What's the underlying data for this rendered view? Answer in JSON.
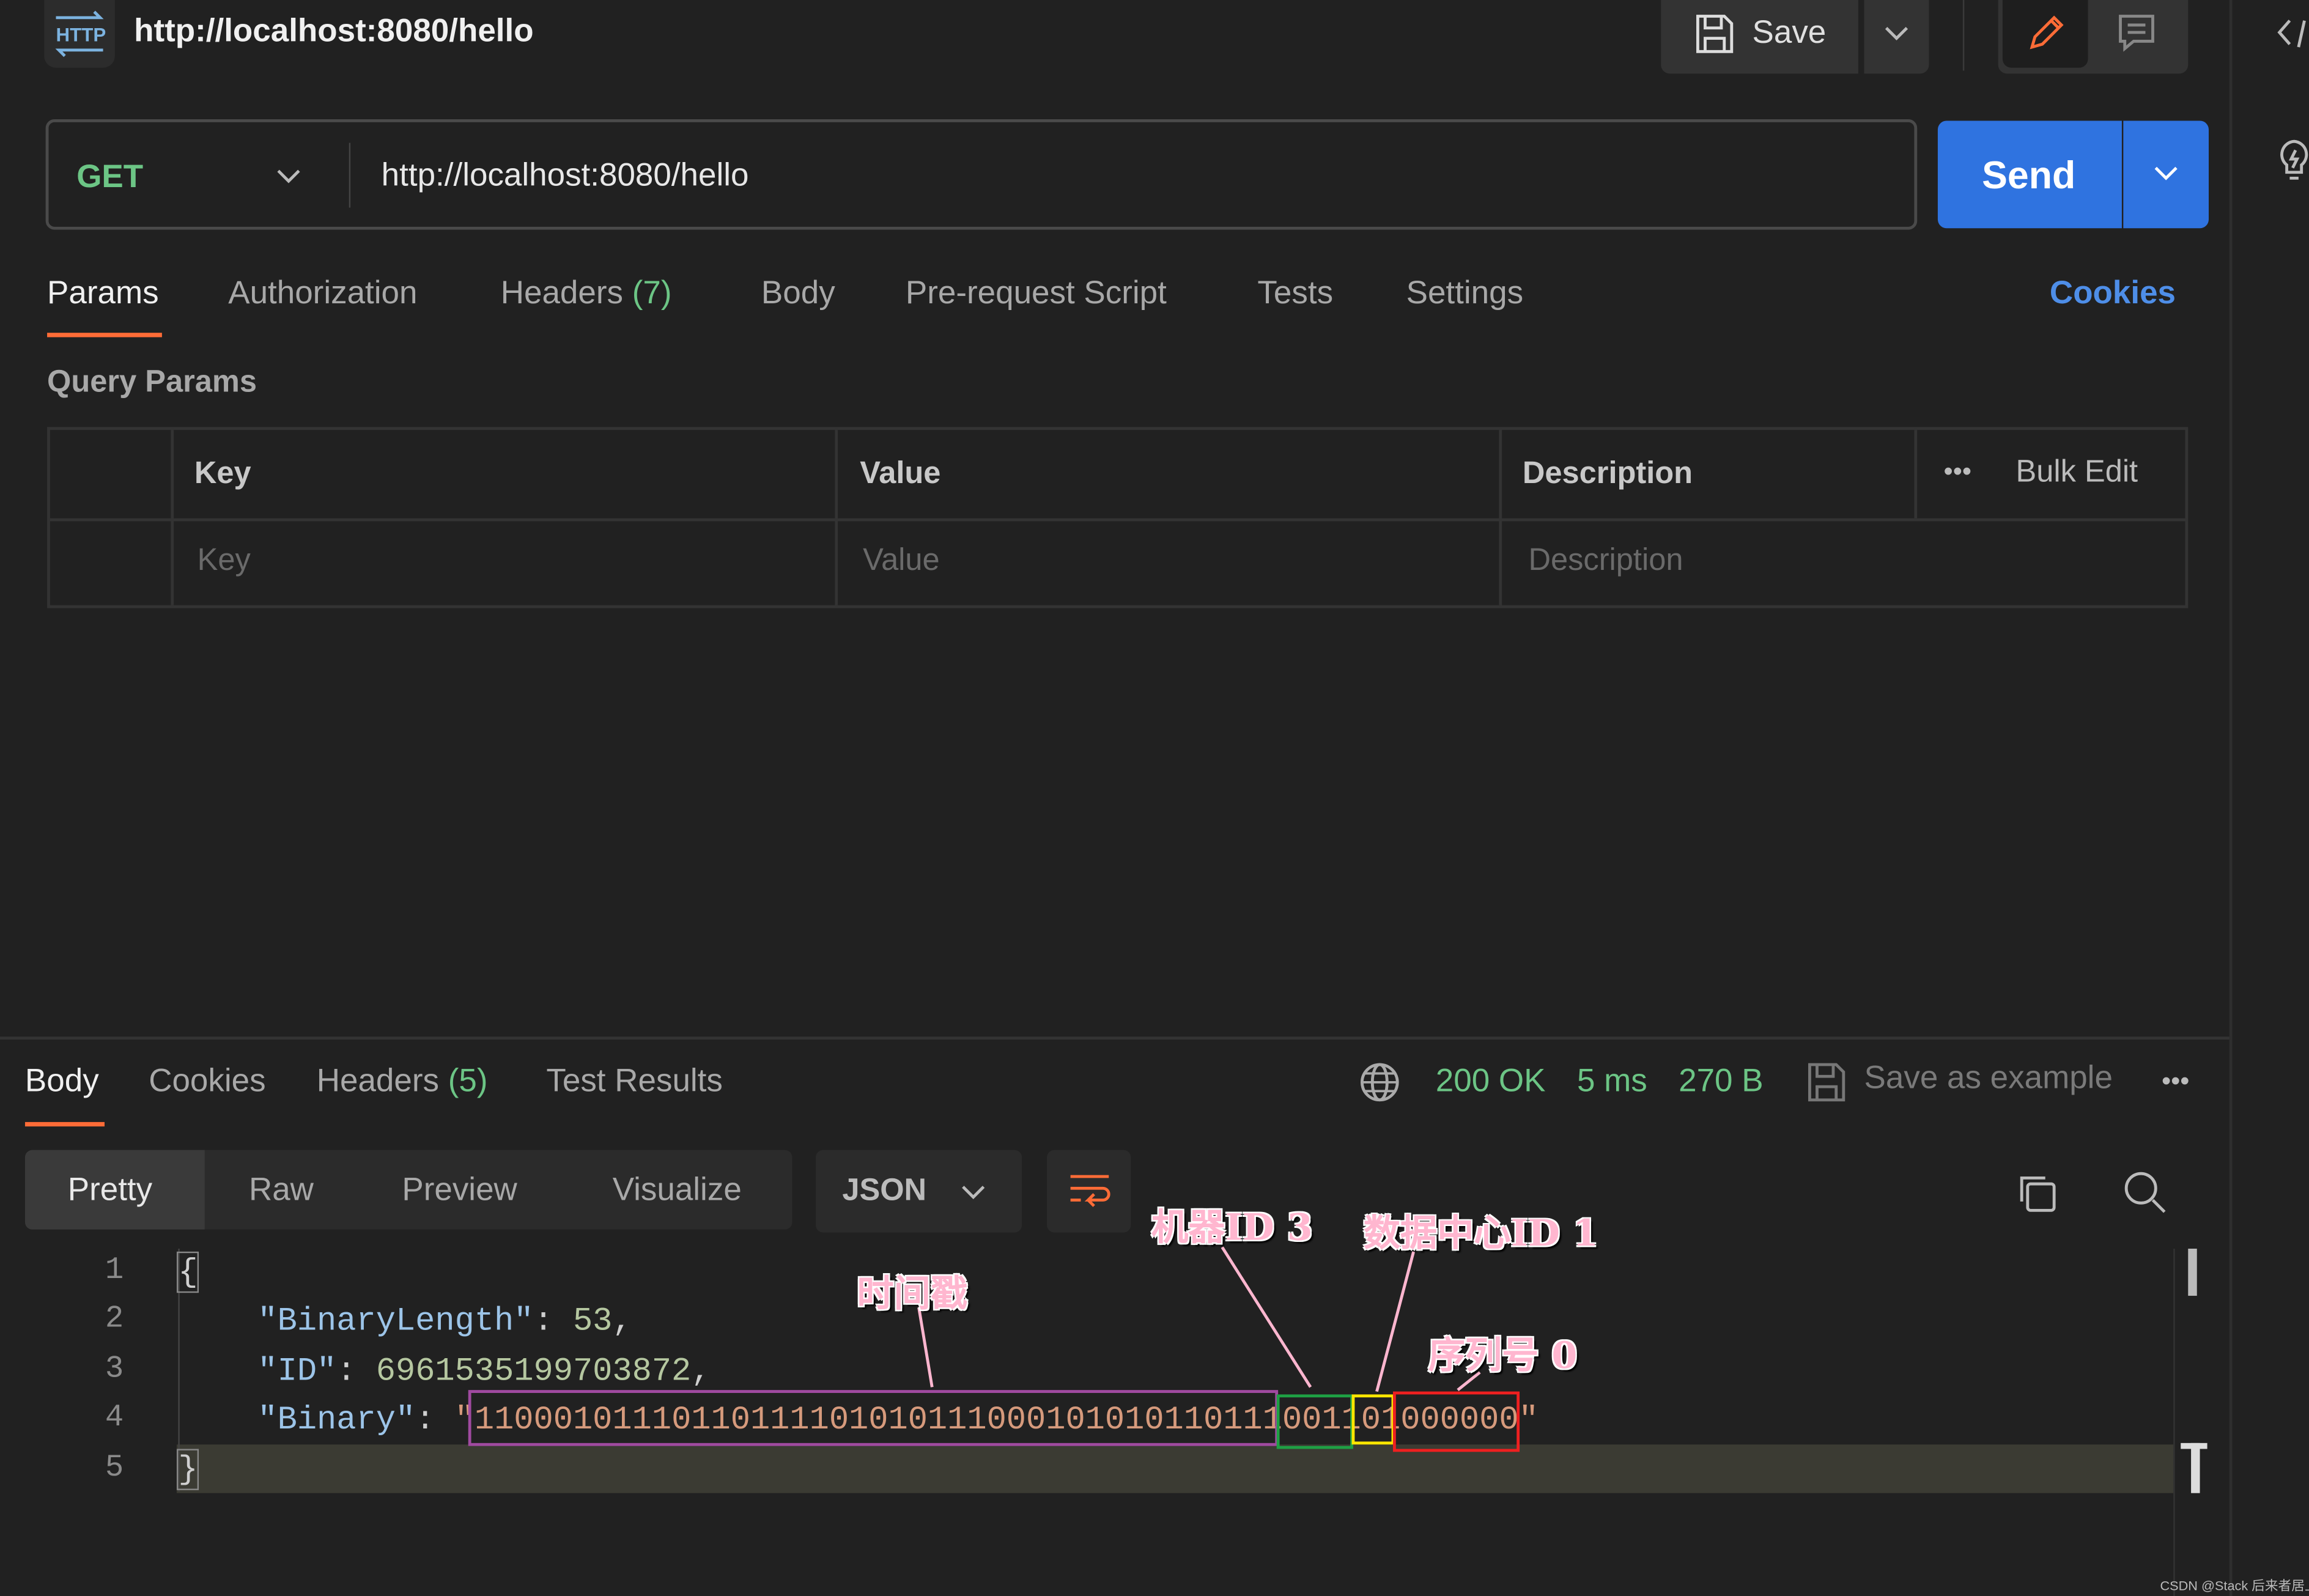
{
  "header": {
    "protocol_icon": "http-icon",
    "title": "http://localhost:8080/hello",
    "save_label": "Save"
  },
  "request": {
    "method": "GET",
    "url": "http://localhost:8080/hello",
    "send_label": "Send"
  },
  "request_tabs": {
    "params": "Params",
    "authorization": "Authorization",
    "headers": "Headers",
    "headers_count": "(7)",
    "body": "Body",
    "prerequest": "Pre-request Script",
    "tests": "Tests",
    "settings": "Settings",
    "cookies": "Cookies"
  },
  "query_params": {
    "title": "Query Params",
    "columns": [
      "Key",
      "Value",
      "Description"
    ],
    "more": "•••",
    "bulk_edit": "Bulk Edit",
    "placeholders": [
      "Key",
      "Value",
      "Description"
    ]
  },
  "response_tabs": {
    "body": "Body",
    "cookies": "Cookies",
    "headers": "Headers",
    "headers_count": "(5)",
    "test_results": "Test Results"
  },
  "response_status": {
    "status": "200 OK",
    "time": "5 ms",
    "size": "270 B",
    "save_example": "Save as example",
    "more": "•••"
  },
  "view_modes": [
    "Pretty",
    "Raw",
    "Preview",
    "Visualize"
  ],
  "format": "JSON",
  "code": {
    "line_numbers": [
      "1",
      "2",
      "3",
      "4",
      "5"
    ],
    "open_brace": "{",
    "close_brace": "}",
    "k1": "\"BinaryLength\"",
    "v1": "53",
    "k2": "\"ID\"",
    "v2": "6961535199703872",
    "k3": "\"Binary\"",
    "binary_timestamp": "11000101110110111101010111000101010110111",
    "binary_machine": "0011",
    "binary_datacenter": "01",
    "binary_sequence": "000000"
  },
  "annotations": {
    "timestamp": "时间戳",
    "machine": "机器ID 3",
    "datacenter": "数据中心ID 1",
    "sequence": "序列号 0"
  },
  "watermark": "CSDN @Stack 后来者居上",
  "colors": {
    "accent": "#2f73e0",
    "status_green": "#6cc585",
    "active_tab": "#ff6c37",
    "ts_box": "#a04aa0",
    "machine_box": "#1ea044",
    "dc_box": "#ffe600",
    "seq_box": "#ee2020",
    "annotation": "#ffb6cf"
  }
}
